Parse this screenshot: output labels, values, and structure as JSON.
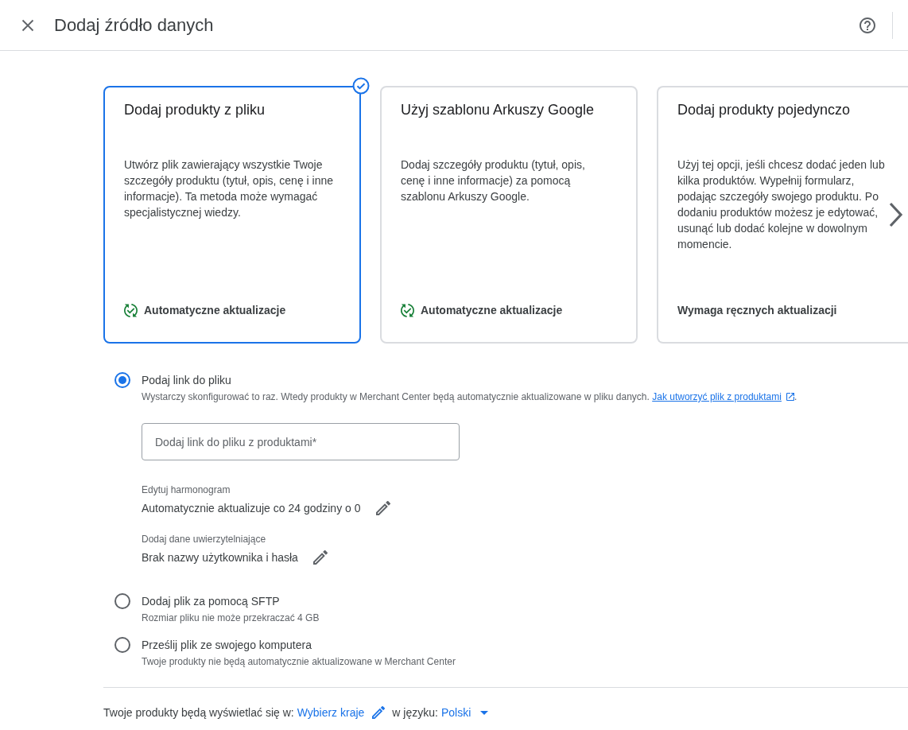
{
  "header": {
    "title": "Dodaj źródło danych"
  },
  "cards": [
    {
      "title": "Dodaj produkty z pliku",
      "description": "Utwórz plik zawierający wszystkie Twoje szczegóły produktu (tytuł, opis, cenę i inne informacje). Ta metoda może wymagać specjalistycznej wiedzy.",
      "update_mode": "Automatyczne aktualizacje",
      "auto_update": true,
      "selected": true
    },
    {
      "title": "Użyj szablonu Arkuszy Google",
      "description": "Dodaj szczegóły produktu (tytuł, opis, cenę i inne informacje) za pomocą szablonu Arkuszy Google.",
      "update_mode": "Automatyczne aktualizacje",
      "auto_update": true,
      "selected": false
    },
    {
      "title": "Dodaj produkty pojedynczo",
      "description": "Użyj tej opcji, jeśli chcesz dodać jeden lub kilka produktów. Wypełnij formularz, podając szczegóły swojego produktu. Po dodaniu produktów możesz je edytować, usunąć lub dodać kolejne w dowolnym momencie.",
      "update_mode": "Wymaga ręcznych aktualizacji",
      "auto_update": false,
      "selected": false
    }
  ],
  "options": [
    {
      "label": "Podaj link do pliku",
      "description": "Wystarczy skonfigurować to raz. Wtedy produkty w Merchant Center będą automatycznie aktualizowane w pliku danych.",
      "help_link": "Jak utworzyć plik z produktami",
      "description_end": ".",
      "selected": true,
      "link_field": {
        "placeholder": "Dodaj link do pliku z produktami*"
      },
      "settings": [
        {
          "label": "Edytuj harmonogram",
          "value": "Automatycznie aktualizuje co 24 godziny o 0"
        },
        {
          "label": "Dodaj dane uwierzytelniające",
          "value": "Brak nazwy użytkownika i hasła"
        }
      ]
    },
    {
      "label": "Dodaj plik za pomocą SFTP",
      "description": "Rozmiar pliku nie może przekraczać 4 GB",
      "selected": false
    },
    {
      "label": "Prześlij plik ze swojego komputera",
      "description": "Twoje produkty nie będą automatycznie aktualizowane w Merchant Center",
      "selected": false
    }
  ],
  "footer": {
    "prefix": "Twoje produkty będą wyświetlać się w:",
    "countries": "Wybierz kraje",
    "language_prefix": "w języku:",
    "language": "Polski"
  }
}
